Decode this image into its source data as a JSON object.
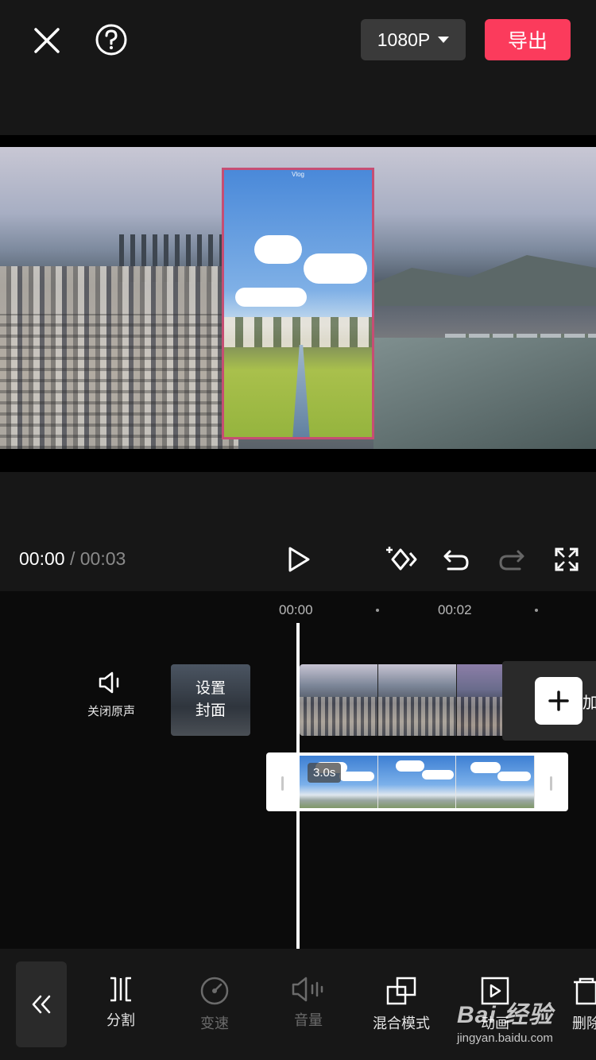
{
  "header": {
    "resolution_label": "1080P",
    "export_label": "导出",
    "accent_color": "#fb3b5c"
  },
  "icons": {
    "close": "close-icon",
    "help": "help-icon",
    "dropdown": "caret-down-icon",
    "play": "play-icon",
    "keyframe": "add-keyframe-icon",
    "undo": "undo-icon",
    "redo": "redo-icon",
    "fullscreen": "fullscreen-icon"
  },
  "preview": {
    "overlay_watermark": "Vlog"
  },
  "playback": {
    "current_time": "00:00",
    "separator": "/",
    "total_time": "00:03"
  },
  "timeline": {
    "ruler": [
      "00:00",
      "00:02"
    ],
    "mute_label": "关闭原声",
    "cover_label": "设置封面",
    "pip_duration": "3.0s",
    "add_hint": "加片尾"
  },
  "toolbar": {
    "items": [
      {
        "label": "分割",
        "enabled": true
      },
      {
        "label": "变速",
        "enabled": false
      },
      {
        "label": "音量",
        "enabled": false
      },
      {
        "label": "混合模式",
        "enabled": true
      },
      {
        "label": "动画",
        "enabled": true
      },
      {
        "label": "删除",
        "enabled": true
      }
    ]
  },
  "watermark": {
    "brand": "Bai 经验",
    "url": "jingyan.baidu.com"
  }
}
